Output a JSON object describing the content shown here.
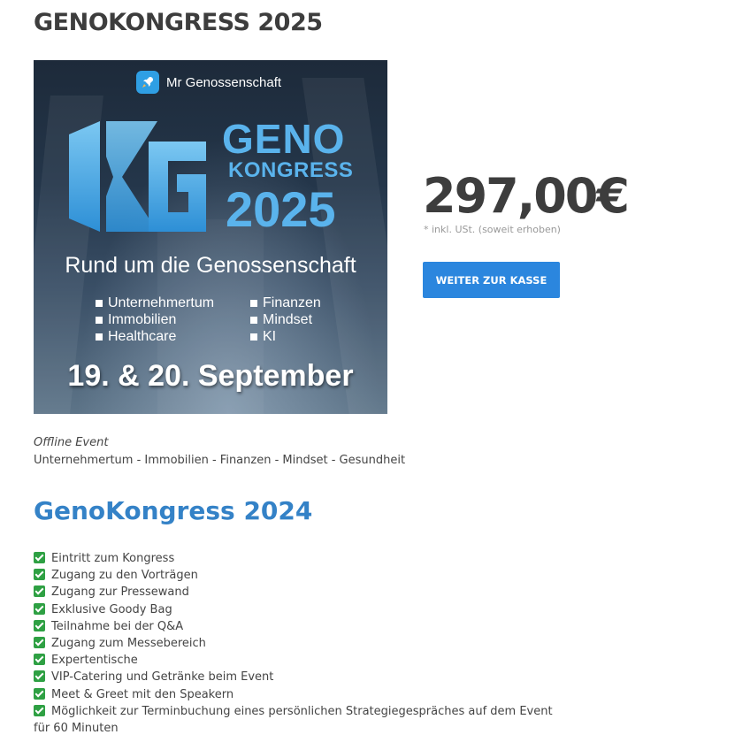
{
  "page": {
    "title": "GENOKONGRESS 2025"
  },
  "banner": {
    "brand": "Mr Genossenschaft",
    "brand_icon": "rocket-icon",
    "headline_line1": "GENO",
    "headline_line2": "KONGRESS",
    "headline_line3": "2025",
    "tagline": "Rund um die Genossenschaft",
    "topics": [
      "Unternehmertum",
      "Finanzen",
      "Immobilien",
      "Mindset",
      "Healthcare",
      "KI"
    ],
    "dates": "19. & 20. September",
    "accent_color": "#5ab3ec"
  },
  "product": {
    "price": "297,00€",
    "price_note": "* inkl. USt. (soweit erhoben)",
    "checkout_label": "WEITER ZUR KASSE",
    "checkout_color": "#2b86de"
  },
  "event": {
    "type": "Offline Event",
    "topics": "Unternehmertum - Immobilien - Finanzen - Mindset - Gesundheit"
  },
  "section": {
    "heading": "GenoKongress 2024",
    "heading_color": "#3482c7"
  },
  "features": [
    "Eintritt zum Kongress",
    "Zugang zu den Vorträgen",
    "Zugang zur Pressewand",
    "Exklusive Goody Bag",
    "Teilnahme bei der Q&A",
    "Zugang zum Messebereich",
    "Expertentische",
    "VIP-Catering und Getränke beim Event",
    "Meet & Greet mit den Speakern",
    "Möglichkeit zur Terminbuchung eines persönlichen Strategiegespräches auf dem Event für 60 Minuten"
  ],
  "feature_icon": "green-checkmark-icon"
}
